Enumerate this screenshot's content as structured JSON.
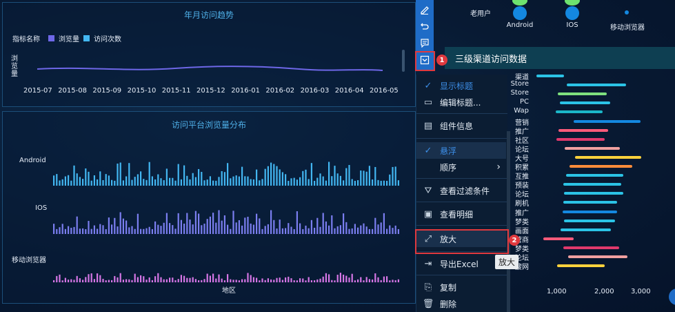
{
  "trend": {
    "title": "年月访问趋势",
    "legend_label": "指标名称",
    "legend_items": [
      {
        "name": "浏览量",
        "color": "#6e67e8"
      },
      {
        "name": "访问次数",
        "color": "#43b7f2"
      }
    ],
    "y_axis_label": "浏览量",
    "x_labels": [
      "2015-07",
      "2015-08",
      "2015-09",
      "2015-10",
      "2015-11",
      "2015-12",
      "2016-01",
      "2016-02",
      "2016-03",
      "2016-04",
      "2016-05"
    ]
  },
  "platform": {
    "title": "访问平台浏览量分布",
    "rows": [
      "Android",
      "IOS",
      "移动浏览器"
    ],
    "x_axis_label": "地区",
    "colors": [
      "#43b7f2",
      "#7b7ef0",
      "#d676e6"
    ]
  },
  "toolbar": {
    "icons": [
      "edit-icon",
      "undo-icon",
      "comment-icon",
      "dropdown-icon"
    ]
  },
  "menu": {
    "items": [
      {
        "label": "显示标题",
        "icon": "check-icon",
        "active": true
      },
      {
        "label": "编辑标题...",
        "icon": "edit-title-icon",
        "active": false
      },
      {
        "label": "组件信息",
        "icon": "info-icon",
        "active": false
      },
      {
        "label": "悬浮",
        "icon": "check-icon",
        "active": true
      },
      {
        "label": "顺序",
        "icon": "chevron-right-icon",
        "active": false
      },
      {
        "label": "查看过滤条件",
        "icon": "filter-icon",
        "active": false
      },
      {
        "label": "查看明细",
        "icon": "detail-icon",
        "active": false
      },
      {
        "label": "放大",
        "icon": "zoom-icon",
        "active": false
      },
      {
        "label": "导出Excel",
        "icon": "export-icon",
        "active": false
      },
      {
        "label": "复制",
        "icon": "copy-icon",
        "active": false
      },
      {
        "label": "删除",
        "icon": "delete-icon",
        "active": false
      }
    ]
  },
  "annotations": {
    "badge1": "1",
    "badge2": "2"
  },
  "tooltip": "放大",
  "top_right": {
    "row_label": "老用户",
    "captions": [
      "Android",
      "IOS",
      "移动浏览器"
    ]
  },
  "channel": {
    "title": "三级渠道访问数据",
    "labels": [
      "渠道",
      "Store",
      "Store",
      "PC",
      "Wap",
      "营销",
      "推广",
      "社区",
      "论坛",
      "大号",
      "积累",
      "互推",
      "预装",
      "论坛",
      "刷机",
      "推广",
      "梦类",
      "画面",
      "营商",
      "梦类",
      "论坛",
      "搜网"
    ],
    "ticks": [
      "1,000",
      "2,000",
      "3,000"
    ]
  }
}
